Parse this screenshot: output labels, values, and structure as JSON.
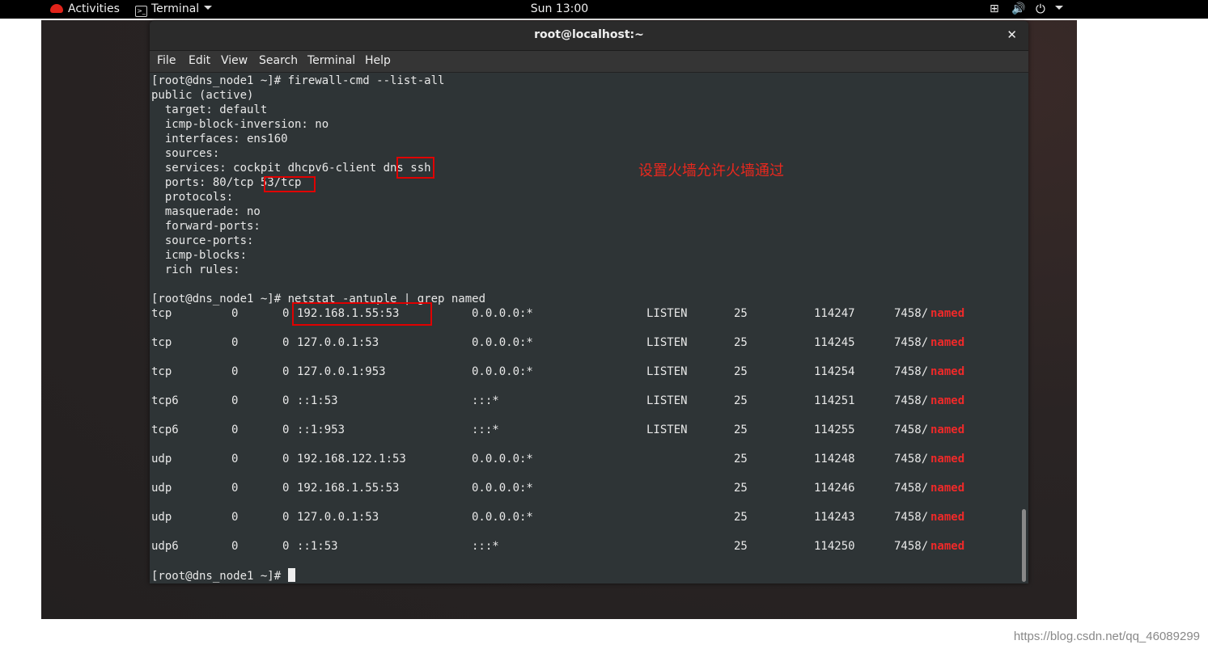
{
  "topbar": {
    "activities": "Activities",
    "app_menu": "Terminal",
    "clock": "Sun 13:00"
  },
  "window": {
    "title": "root@localhost:~",
    "close": "✕",
    "menu": [
      "File",
      "Edit",
      "View",
      "Search",
      "Terminal",
      "Help"
    ]
  },
  "terminal": {
    "prompt": "[root@dns_node1 ~]# ",
    "cmd1": "firewall-cmd --list-all",
    "zone": "public (active)",
    "fw": [
      "  target: default",
      "  icmp-block-inversion: no",
      "  interfaces: ens160",
      "  sources: ",
      "  services: cockpit dhcpv6-client dns ssh",
      "  ports: 80/tcp 53/tcp",
      "  protocols: ",
      "  masquerade: no",
      "  forward-ports: ",
      "  source-ports: ",
      "  icmp-blocks: ",
      "  rich rules: "
    ],
    "cmd2": "netstat -antuple | grep named",
    "netstat": [
      {
        "proto": "tcp",
        "recvq": "0",
        "sendq": "0",
        "local": "192.168.1.55:53",
        "foreign": "0.0.0.0:*",
        "state": "LISTEN",
        "user": "25",
        "inode": "114247",
        "pid": "7458/",
        "prog": "named"
      },
      {
        "proto": "tcp",
        "recvq": "0",
        "sendq": "0",
        "local": "127.0.0.1:53",
        "foreign": "0.0.0.0:*",
        "state": "LISTEN",
        "user": "25",
        "inode": "114245",
        "pid": "7458/",
        "prog": "named"
      },
      {
        "proto": "tcp",
        "recvq": "0",
        "sendq": "0",
        "local": "127.0.0.1:953",
        "foreign": "0.0.0.0:*",
        "state": "LISTEN",
        "user": "25",
        "inode": "114254",
        "pid": "7458/",
        "prog": "named"
      },
      {
        "proto": "tcp6",
        "recvq": "0",
        "sendq": "0",
        "local": "::1:53",
        "foreign": ":::*",
        "state": "LISTEN",
        "user": "25",
        "inode": "114251",
        "pid": "7458/",
        "prog": "named"
      },
      {
        "proto": "tcp6",
        "recvq": "0",
        "sendq": "0",
        "local": "::1:953",
        "foreign": ":::*",
        "state": "LISTEN",
        "user": "25",
        "inode": "114255",
        "pid": "7458/",
        "prog": "named"
      },
      {
        "proto": "udp",
        "recvq": "0",
        "sendq": "0",
        "local": "192.168.122.1:53",
        "foreign": "0.0.0.0:*",
        "state": "",
        "user": "25",
        "inode": "114248",
        "pid": "7458/",
        "prog": "named"
      },
      {
        "proto": "udp",
        "recvq": "0",
        "sendq": "0",
        "local": "192.168.1.55:53",
        "foreign": "0.0.0.0:*",
        "state": "",
        "user": "25",
        "inode": "114246",
        "pid": "7458/",
        "prog": "named"
      },
      {
        "proto": "udp",
        "recvq": "0",
        "sendq": "0",
        "local": "127.0.0.1:53",
        "foreign": "0.0.0.0:*",
        "state": "",
        "user": "25",
        "inode": "114243",
        "pid": "7458/",
        "prog": "named"
      },
      {
        "proto": "udp6",
        "recvq": "0",
        "sendq": "0",
        "local": "::1:53",
        "foreign": ":::*",
        "state": "",
        "user": "25",
        "inode": "114250",
        "pid": "7458/",
        "prog": "named"
      }
    ],
    "annotation": "设置火墙允许火墙通过"
  },
  "watermark": "https://blog.csdn.net/qq_46089299",
  "colors": {
    "highlight_box": "#e00000",
    "named": "#ef2929",
    "terminal_bg": "#2e3436"
  },
  "icons": [
    "redhat-icon",
    "terminal-icon",
    "network-icon",
    "volume-icon",
    "power-icon"
  ]
}
